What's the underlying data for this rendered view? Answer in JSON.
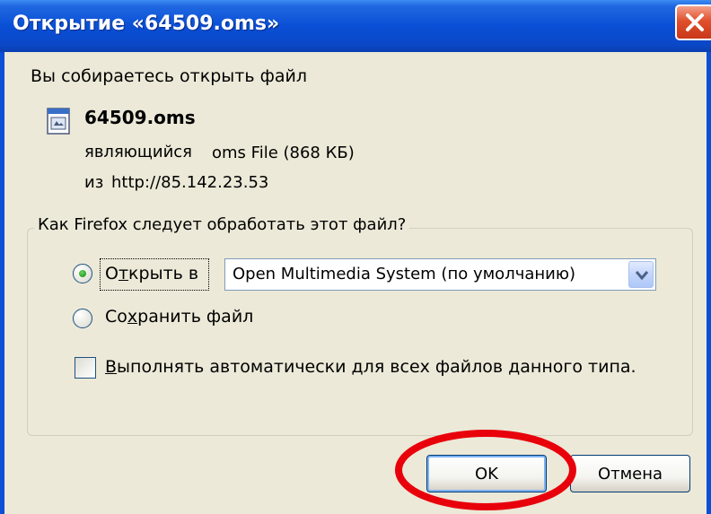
{
  "window": {
    "title": "Открытие «64509.oms»"
  },
  "dialog": {
    "prompt": "Вы собираетесь открыть файл",
    "file_name": "64509.oms",
    "type_label": "являющийся",
    "type_value": "oms File (868 КБ)",
    "from_label": "из",
    "from_value": "http://85.142.23.53",
    "question": "Как Firefox следует обработать этот файл?",
    "open_with": {
      "label_pre": "О",
      "label_u": "т",
      "label_post": "крыть в",
      "selected": true,
      "app_value": "Open Multimedia System (по умолчанию)"
    },
    "save_file": {
      "label_pre": "Со",
      "label_u": "х",
      "label_post": "ранить файл",
      "selected": false
    },
    "auto": {
      "label_pre": "",
      "label_u": "В",
      "label_post": "ыполнять автоматически для всех файлов данного типа.",
      "checked": false
    }
  },
  "buttons": {
    "ok": "OK",
    "cancel": "Отмена"
  },
  "colors": {
    "title_bar": "#0a4fd6",
    "annotation": "#e8000b"
  }
}
